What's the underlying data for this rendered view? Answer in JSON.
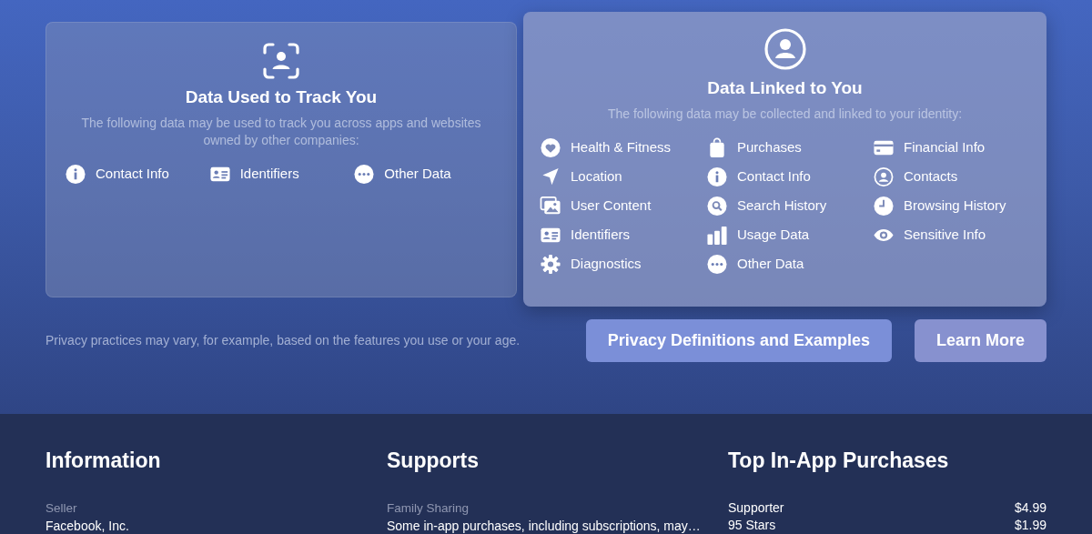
{
  "privacy_cards": [
    {
      "title": "Data Used to Track You",
      "focused": false,
      "description": "The following data may be used to track you across apps and websites owned by other companies:",
      "items": [
        "Contact Info",
        "Identifiers",
        "Other Data"
      ]
    },
    {
      "title": "Data Linked to You",
      "focused": true,
      "description": "The following data may be collected and linked to your identity:",
      "items": [
        "Health & Fitness",
        "Purchases",
        "Financial Info",
        "Location",
        "Contact Info",
        "Contacts",
        "User Content",
        "Search History",
        "Browsing History",
        "Identifiers",
        "Usage Data",
        "Sensitive Info",
        "Diagnostics",
        "Other Data"
      ]
    }
  ],
  "note": "Privacy practices may vary, for example, based on the features you use or your age.",
  "buttons": [
    "Privacy Definitions and Examples",
    "Learn More"
  ],
  "information": {
    "title": "Information",
    "label": "Seller",
    "value": "Facebook, Inc."
  },
  "supports": {
    "title": "Supports",
    "label": "Family Sharing",
    "value": "Some in-app purchases, including subscriptions, may…"
  },
  "purchases": {
    "title": "Top In-App Purchases",
    "rows": [
      {
        "name": "Supporter",
        "price": "$4.99"
      },
      {
        "name": "95 Stars",
        "price": "$1.99"
      }
    ]
  }
}
